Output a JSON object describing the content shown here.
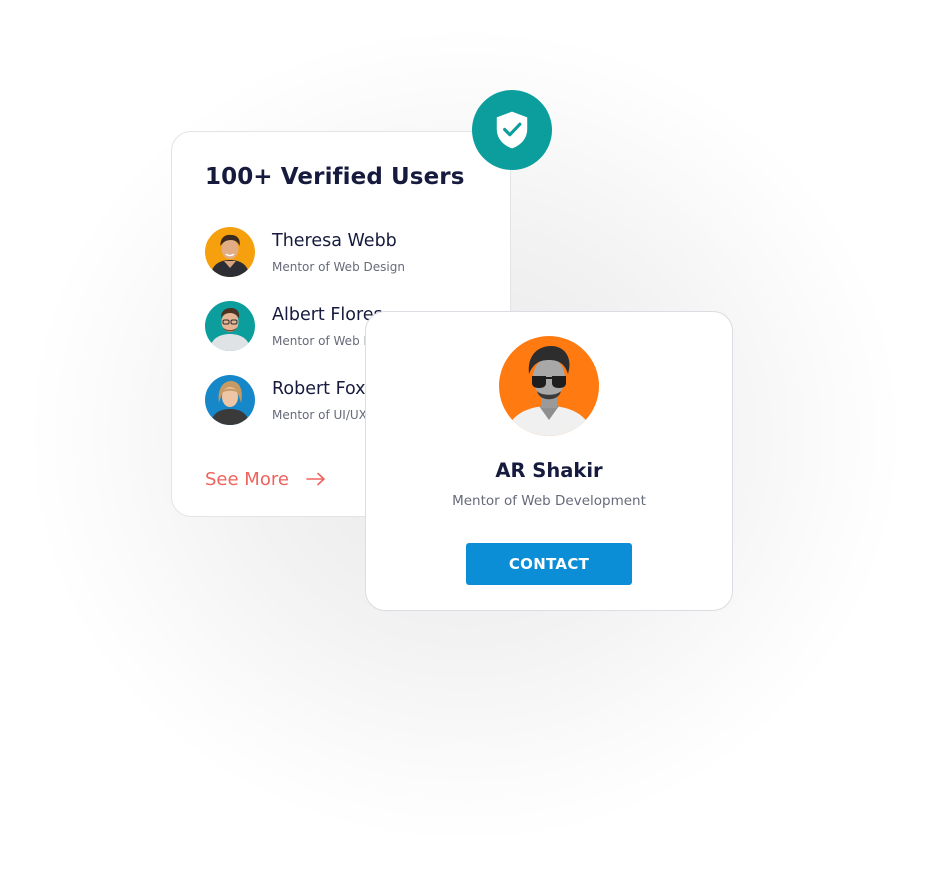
{
  "users_card": {
    "title": "100+ Verified Users",
    "users": [
      {
        "name": "Theresa Webb",
        "role": "Mentor of Web Design",
        "avatar_bg": "#f5a00c",
        "avatar_icon": "person-avatar"
      },
      {
        "name": "Albert Flores",
        "role": "Mentor of Web Design",
        "avatar_bg": "#0b9e9c",
        "avatar_icon": "person-avatar"
      },
      {
        "name": "Robert Fox",
        "role": "Mentor of UI/UX Design",
        "avatar_bg": "#1687c9",
        "avatar_icon": "person-avatar"
      }
    ],
    "see_more_label": "See More",
    "see_more_icon": "arrow-right-icon"
  },
  "verified_badge": {
    "icon": "shield-check-icon",
    "color": "#0b9e9c"
  },
  "profile_card": {
    "name": "AR Shakir",
    "role": "Mentor of Web Development",
    "avatar_bg": "#ff7a11",
    "contact_label": "CONTACT"
  },
  "colors": {
    "heading": "#161b3d",
    "muted": "#666a7a",
    "accent_link": "#f0625d",
    "button": "#0b8ed6",
    "teal": "#0b9e9c"
  }
}
